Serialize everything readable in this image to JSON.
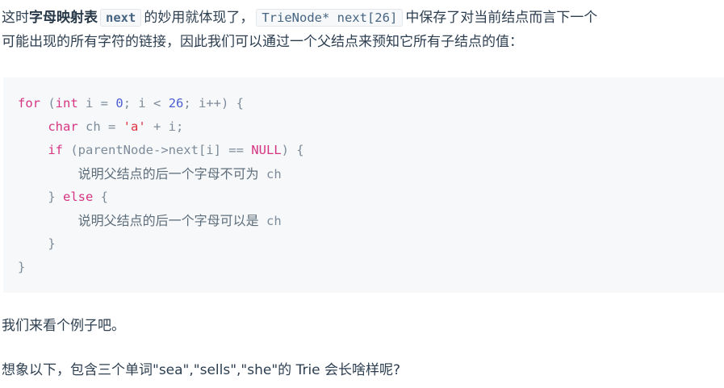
{
  "paragraph1": {
    "line1_pre": "这时",
    "line1_bold": "字母映射表",
    "inline_code_1": "next",
    "line1_mid": "的妙用就体现了，",
    "inline_code_2": "TrieNode* next[26]",
    "line1_post": "中保存了对当前结点而言下一个",
    "line2": "可能出现的所有字符的链接，因此我们可以通过一个父结点来预知它所有子结点的值："
  },
  "code": {
    "l1_kw_for": "for",
    "l1_a": " (",
    "l1_kw_int": "int",
    "l1_b": " i = ",
    "l1_num_0": "0",
    "l1_c": "; i < ",
    "l1_num_26": "26",
    "l1_d": "; i++) {",
    "l2_indent": "    ",
    "l2_kw_char": "char",
    "l2_a": " ch = ",
    "l2_str": "'a'",
    "l2_b": " + i;",
    "l3_indent": "    ",
    "l3_kw_if": "if",
    "l3_a": " (parentNode->next[i] == ",
    "l3_kw_null": "NULL",
    "l3_b": ") {",
    "l4_indent": "        ",
    "l4_cjk": "说明父结点的后一个字母不可为",
    "l4_tail": " ch",
    "l5_indent": "    ",
    "l5_a": "} ",
    "l5_kw_else": "else",
    "l5_b": " {",
    "l6_indent": "        ",
    "l6_cjk": "说明父结点的后一个字母可以是",
    "l6_tail": " ch",
    "l7": "    }",
    "l8": "}"
  },
  "paragraph2": "我们来看个例子吧。",
  "paragraph3": "想象以下，包含三个单词\"sea\",\"sells\",\"she\"的 Trie 会长啥样呢?"
}
